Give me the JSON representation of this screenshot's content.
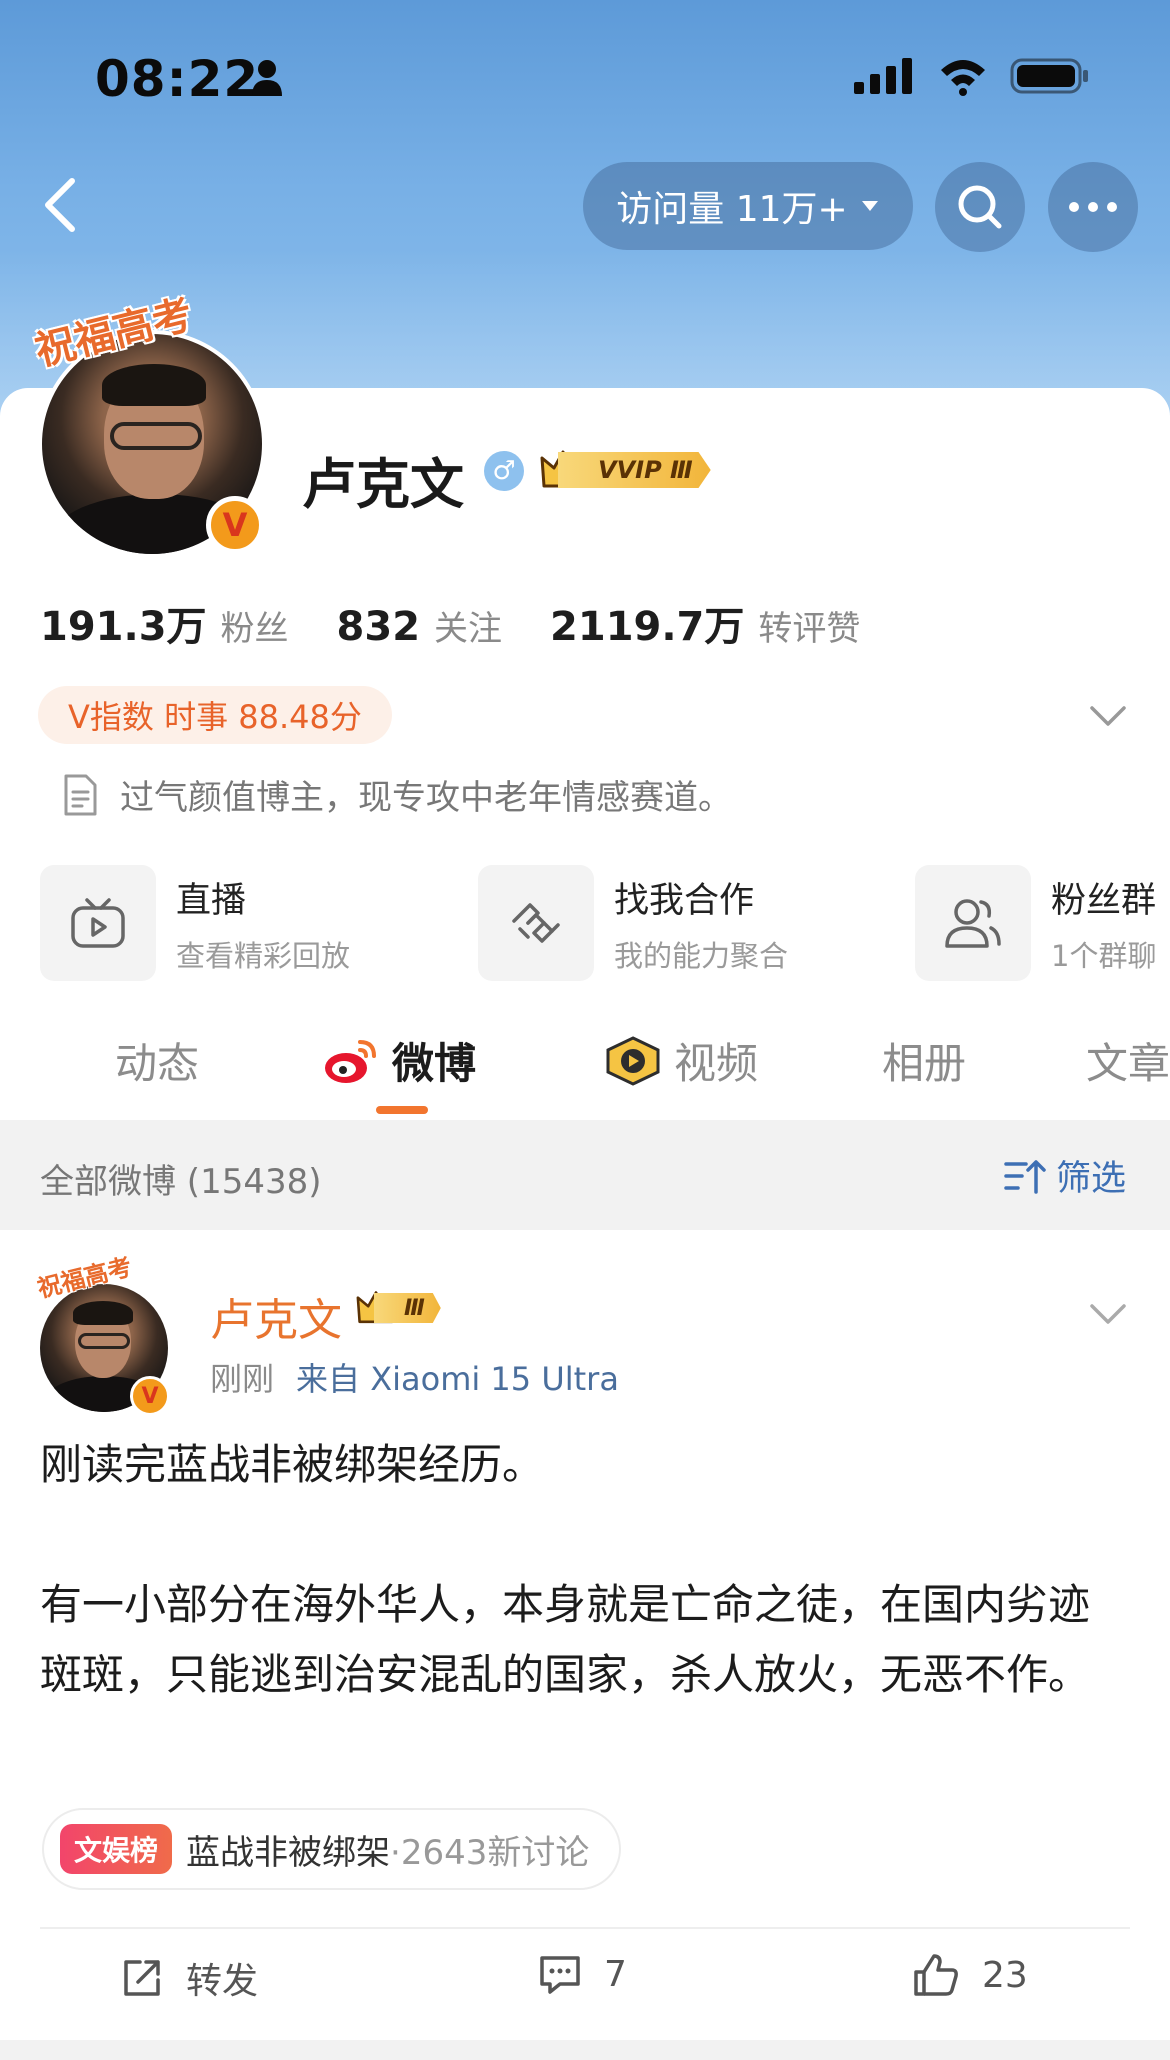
{
  "status_bar": {
    "time": "08:22"
  },
  "nav": {
    "visit_label": "访问量 11万+"
  },
  "profile": {
    "avatar_banner": "祝福高考",
    "name": "卢克文",
    "vip_label": "VVIP Ⅲ",
    "stats": [
      {
        "value": "191.3万",
        "label": "粉丝"
      },
      {
        "value": "832",
        "label": "关注"
      },
      {
        "value": "2119.7万",
        "label": "转评赞"
      }
    ],
    "v_index": "V指数 时事 88.48分",
    "bio": "过气颜值博主，现专攻中老年情感赛道。"
  },
  "entries": [
    {
      "title": "直播",
      "subtitle": "查看精彩回放"
    },
    {
      "title": "找我合作",
      "subtitle": "我的能力聚合"
    },
    {
      "title": "粉丝群",
      "subtitle": "1个群聊"
    }
  ],
  "tabs": [
    "动态",
    "微博",
    "视频",
    "相册",
    "文章"
  ],
  "filter": {
    "count_label": "全部微博 (15438)",
    "filter_label": "筛选"
  },
  "post": {
    "avatar_banner": "祝福高考",
    "author": "卢克文",
    "crown_label": "Ⅲ",
    "time": "刚刚",
    "source": "来自 Xiaomi 15 Ultra",
    "paragraphs": [
      "刚读完蓝战非被绑架经历。",
      "有一小部分在海外华人，本身就是亡命之徒，在国内劣迹斑斑，只能逃到治安混乱的国家，杀人放火，无恶不作。"
    ],
    "topic": {
      "tag": "文娱榜",
      "title": "蓝战非被绑架",
      "count": "·2643新讨论"
    },
    "actions": {
      "repost": "转发",
      "comments": "7",
      "likes": "23"
    }
  },
  "colors": {
    "accent": "#f2752e",
    "link": "#3d6fb4",
    "author": "#e8742e",
    "sky": "#78b0e6"
  }
}
